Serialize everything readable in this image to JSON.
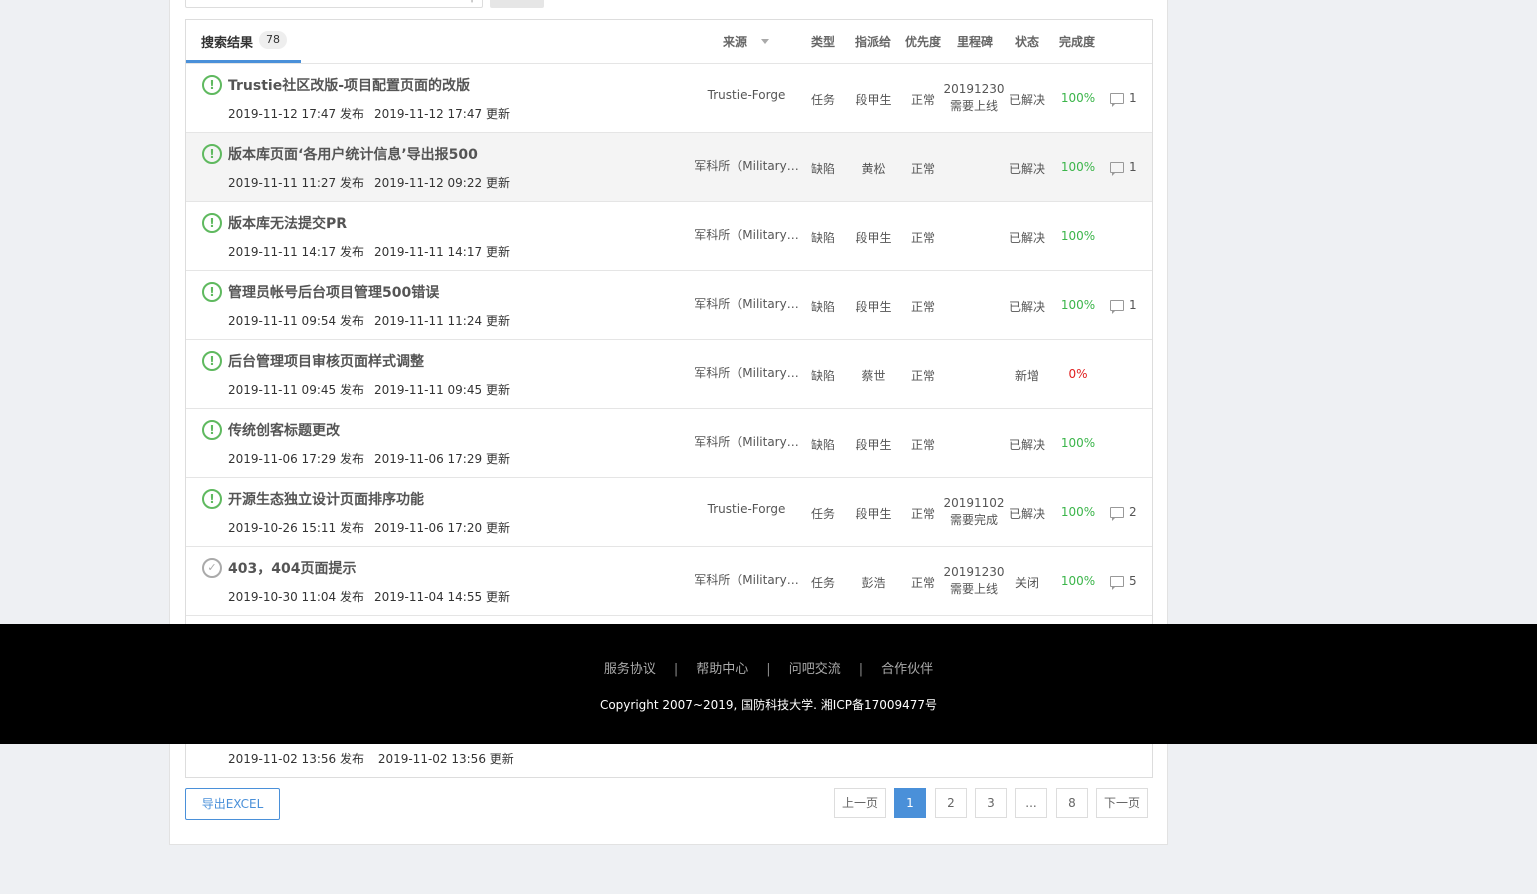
{
  "search": {
    "placeholder": ""
  },
  "tab": {
    "label": "搜索结果",
    "count": "78"
  },
  "columns": {
    "source": "来源",
    "type": "类型",
    "assignee": "指派给",
    "priority": "优先度",
    "milestone": "里程碑",
    "status": "状态",
    "progress": "完成度"
  },
  "issues": [
    {
      "title": "Trustie社区改版-项目配置页面的改版",
      "published": "2019-11-12 17:47",
      "pub_suffix": "发布",
      "updated": "2019-11-12 17:47",
      "upd_suffix": "更新",
      "source": "Trustie-Forge",
      "type": "任务",
      "assignee": "段甲生",
      "priority": "正常",
      "milestone_1": "20191230",
      "milestone_2": "需要上线",
      "status": "已解决",
      "progress": "100%",
      "comments": "1",
      "icon": "exclamation-icon"
    },
    {
      "title": "版本库页面‘各用户统计信息’导出报500",
      "published": "2019-11-11 11:27",
      "pub_suffix": "发布",
      "updated": "2019-11-12 09:22",
      "upd_suffix": "更新",
      "source": "军科所（Military…",
      "type": "缺陷",
      "assignee": "黄松",
      "priority": "正常",
      "milestone_1": "",
      "milestone_2": "",
      "status": "已解决",
      "progress": "100%",
      "comments": "1",
      "icon": "exclamation-icon"
    },
    {
      "title": "版本库无法提交PR",
      "published": "2019-11-11 14:17",
      "pub_suffix": "发布",
      "updated": "2019-11-11 14:17",
      "upd_suffix": "更新",
      "source": "军科所（Military…",
      "type": "缺陷",
      "assignee": "段甲生",
      "priority": "正常",
      "milestone_1": "",
      "milestone_2": "",
      "status": "已解决",
      "progress": "100%",
      "comments": "",
      "icon": "exclamation-icon"
    },
    {
      "title": "管理员帐号后台项目管理500错误",
      "published": "2019-11-11 09:54",
      "pub_suffix": "发布",
      "updated": "2019-11-11 11:24",
      "upd_suffix": "更新",
      "source": "军科所（Military…",
      "type": "缺陷",
      "assignee": "段甲生",
      "priority": "正常",
      "milestone_1": "",
      "milestone_2": "",
      "status": "已解决",
      "progress": "100%",
      "comments": "1",
      "icon": "exclamation-icon"
    },
    {
      "title": "后台管理项目审核页面样式调整",
      "published": "2019-11-11 09:45",
      "pub_suffix": "发布",
      "updated": "2019-11-11 09:45",
      "upd_suffix": "更新",
      "source": "军科所（Military…",
      "type": "缺陷",
      "assignee": "蔡世",
      "priority": "正常",
      "milestone_1": "",
      "milestone_2": "",
      "status": "新增",
      "progress": "0%",
      "comments": "",
      "icon": "exclamation-icon"
    },
    {
      "title": "传统创客标题更改",
      "published": "2019-11-06 17:29",
      "pub_suffix": "发布",
      "updated": "2019-11-06 17:29",
      "upd_suffix": "更新",
      "source": "军科所（Military…",
      "type": "缺陷",
      "assignee": "段甲生",
      "priority": "正常",
      "milestone_1": "",
      "milestone_2": "",
      "status": "已解决",
      "progress": "100%",
      "comments": "",
      "icon": "exclamation-icon"
    },
    {
      "title": "开源生态独立设计页面排序功能",
      "published": "2019-10-26 15:11",
      "pub_suffix": "发布",
      "updated": "2019-11-06 17:20",
      "upd_suffix": "更新",
      "source": "Trustie-Forge",
      "type": "任务",
      "assignee": "段甲生",
      "priority": "正常",
      "milestone_1": "20191102",
      "milestone_2": "需要完成",
      "status": "已解决",
      "progress": "100%",
      "comments": "2",
      "icon": "exclamation-icon"
    },
    {
      "title": "403，404页面提示",
      "published": "2019-10-30 11:04",
      "pub_suffix": "发布",
      "updated": "2019-11-04 14:55",
      "upd_suffix": "更新",
      "source": "军科所（Military…",
      "type": "任务",
      "assignee": "彭浩",
      "priority": "正常",
      "milestone_1": "20191230",
      "milestone_2": "需要上线",
      "status": "关闭",
      "progress": "100%",
      "comments": "5",
      "icon": "check-circle-icon"
    }
  ],
  "partial_row": {
    "published": "2019-11-02 13:56",
    "pub_suffix": "发布",
    "updated": "2019-11-02 13:56",
    "upd_suffix": "更新"
  },
  "footer": {
    "links": [
      "服务协议",
      "帮助中心",
      "问吧交流",
      "合作伙伴"
    ],
    "separator": "|",
    "copyright": "Copyright 2007~2019, 国防科技大学.   湘ICP备17009477号"
  },
  "export_label": "导出EXCEL",
  "pagination": {
    "prev": "上一页",
    "pages": [
      "1",
      "2",
      "3",
      "...",
      "8"
    ],
    "next": "下一页",
    "current": "1"
  },
  "colors": {
    "accent": "#4a90d9",
    "progress_done": "#3bb54a",
    "progress_zero": "#e02020",
    "status_icon": "#5fb95f"
  }
}
